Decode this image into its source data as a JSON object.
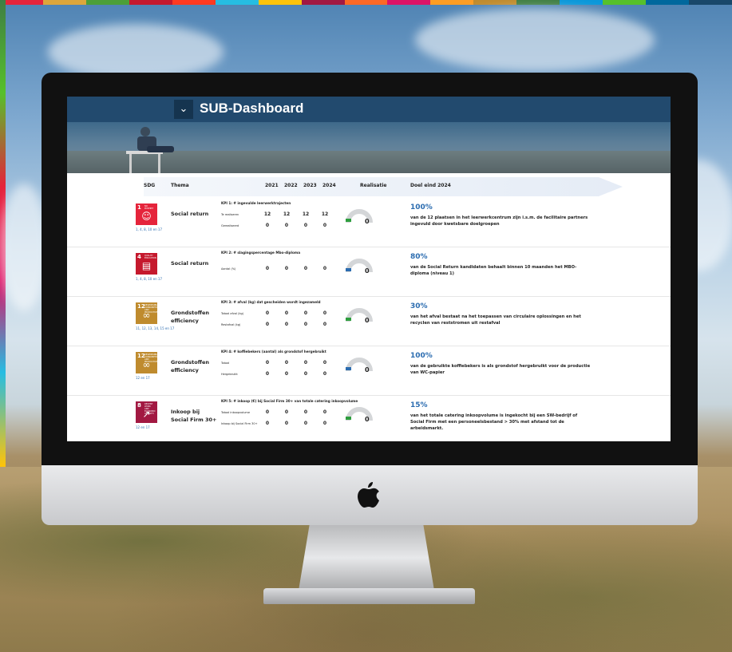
{
  "colors": {
    "header_bar": "#224a6e",
    "accent_blue": "#2b6cb0",
    "sdg_top_strip": [
      "#e5243b",
      "#dda63a",
      "#4c9f38",
      "#c5192d",
      "#ff3a21",
      "#26bde2",
      "#fcc30b",
      "#a21942",
      "#fd6925",
      "#dd1367",
      "#fd9d24",
      "#bf8b2e",
      "#3f7e44",
      "#0a97d9",
      "#56c02b",
      "#00689d",
      "#19486a"
    ]
  },
  "header": {
    "menu_icon": "chevron-down-icon",
    "title": "SUB-Dashboard"
  },
  "table_headers": {
    "sdg": "SDG",
    "thema": "Thema",
    "years": [
      "2021",
      "2022",
      "2023",
      "2024"
    ],
    "realisatie": "Realisatie",
    "doel": "Doel eind 2024"
  },
  "rows": [
    {
      "sdg_number": "1",
      "sdg_caption": "NO POVERTY",
      "sdg_color": "#e5243b",
      "sdg_icon": "family-icon",
      "sdg_links": "1, 4, 8, 10 en 17",
      "thema": "Social return",
      "kpi": "KPI 1: # ingevulde leerwerktrajecten",
      "metrics": [
        {
          "label": "Te realiseren",
          "values": [
            "12",
            "12",
            "12",
            "12"
          ]
        },
        {
          "label": "Gerealiseerd",
          "values": [
            "0",
            "0",
            "0",
            "0"
          ]
        }
      ],
      "gauge_value": "0",
      "gauge_fraction": 0,
      "gauge_marker_color": "#2e9e3e",
      "target_pct": "100%",
      "goal": "van de 12 plaatsen in het leerwerkcentrum zijn i.s.m. de facilitaire partners ingevuld door kwetsbare doelgroepen"
    },
    {
      "sdg_number": "4",
      "sdg_caption": "QUALITY EDUCATION",
      "sdg_color": "#c5192d",
      "sdg_icon": "book-icon",
      "sdg_links": "1, 4, 8, 10 en 17",
      "thema": "Social return",
      "kpi": "KPI 2: # slagingspercentage Mbo-diploma",
      "metrics": [
        {
          "label": "Aantal (%)",
          "values": [
            "0",
            "0",
            "0",
            "0"
          ]
        }
      ],
      "gauge_value": "0",
      "gauge_fraction": 0,
      "gauge_marker_color": "#2b6cb0",
      "target_pct": "80%",
      "goal": "van de Social Return kandidaten behaalt binnen 10 maanden het MBO-diploma (niveau 1)"
    },
    {
      "sdg_number": "12",
      "sdg_caption": "RESPONSIBLE CONSUMPTION AND PRODUCTION",
      "sdg_color": "#bf8b2e",
      "sdg_icon": "infinity-icon",
      "sdg_links": "11, 12, 13, 14, 15 en 17",
      "thema": "Grondstoffen efficiency",
      "kpi": "KPI 3: # afval (kg) dat gescheiden wordt ingezameld",
      "metrics": [
        {
          "label": "Totaal afval (kg)",
          "values": [
            "0",
            "0",
            "0",
            "0"
          ]
        },
        {
          "label": "Restafval (kg)",
          "values": [
            "0",
            "0",
            "0",
            "0"
          ]
        }
      ],
      "gauge_value": "0",
      "gauge_fraction": 0,
      "gauge_marker_color": "#2e9e3e",
      "target_pct": "30%",
      "goal": "van het afval bestaat na het toepassen van circulaire oplossingen en  het recyclen van  reststromen uit restafval"
    },
    {
      "sdg_number": "12",
      "sdg_caption": "RESPONSIBLE CONSUMPTION AND PRODUCTION",
      "sdg_color": "#bf8b2e",
      "sdg_icon": "infinity-icon",
      "sdg_links": "12 en 17",
      "thema": "Grondstoffen efficiency",
      "kpi": "KPI 4: # koffiebekers (aantal) als grondstof hergebruikt",
      "metrics": [
        {
          "label": "Totaal",
          "values": [
            "0",
            "0",
            "0",
            "0"
          ]
        },
        {
          "label": "Hergebruikt",
          "values": [
            "0",
            "0",
            "0",
            "0"
          ]
        }
      ],
      "gauge_value": "0",
      "gauge_fraction": 0,
      "gauge_marker_color": "#2b6cb0",
      "target_pct": "100%",
      "goal": "van de gebruikte koffiebekers is als grondstof hergebruikt voor de productie van WC-papier"
    },
    {
      "sdg_number": "8",
      "sdg_caption": "DECENT WORK AND ECONOMIC GROWTH",
      "sdg_color": "#a21942",
      "sdg_icon": "growth-chart-icon",
      "sdg_links": "12 en 17",
      "thema": "Inkoop bij Social Firm 30+",
      "kpi": "KPI 5: # inkoop (€) bij Social Firm 30+ van totale catering inkoopvolume",
      "metrics": [
        {
          "label": "Totaal inkoopvolume",
          "values": [
            "0",
            "0",
            "0",
            "0"
          ]
        },
        {
          "label": "Inkoop bij Social Firm 30+",
          "values": [
            "0",
            "0",
            "0",
            "0"
          ]
        }
      ],
      "gauge_value": "0",
      "gauge_fraction": 0,
      "gauge_marker_color": "#2e9e3e",
      "target_pct": "15%",
      "goal": "van het totale catering inkoopvolume is ingekocht bij een SW-bedrijf of Social Firm met een personeelsbestand > 30% met afstand tot de arbeidsmarkt."
    }
  ]
}
